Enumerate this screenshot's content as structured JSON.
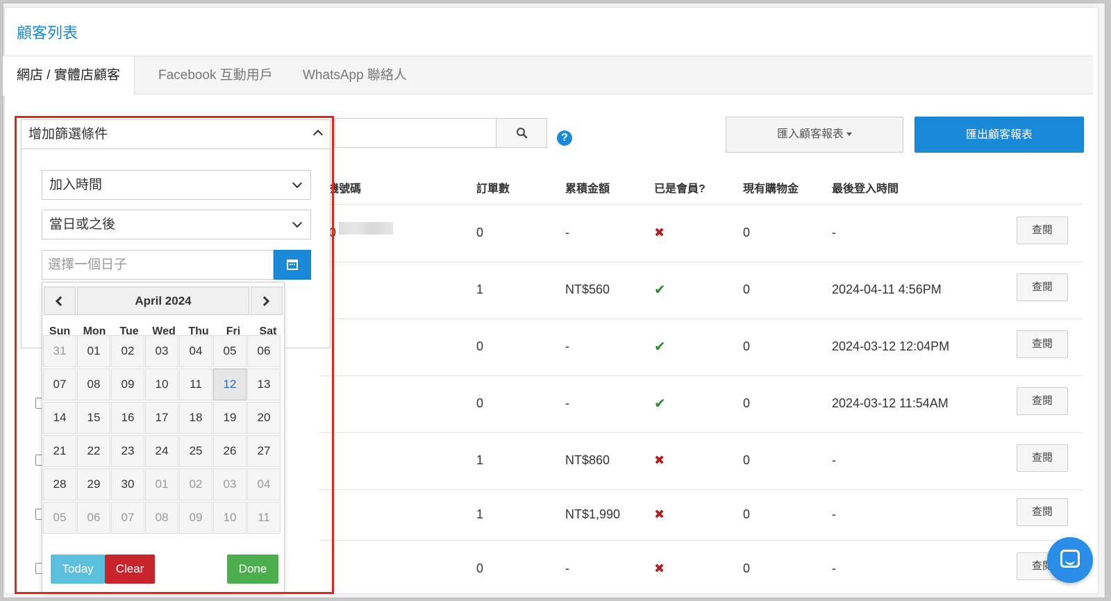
{
  "page_title": "顧客列表",
  "tabs": [
    {
      "label": "網店 / 實體店顧客"
    },
    {
      "label": "Facebook 互動用戶"
    },
    {
      "label": "WhatsApp 聯絡人"
    }
  ],
  "toolbar": {
    "import_label": "匯入顧客報表",
    "export_label": "匯出顧客報表",
    "help_label": "?"
  },
  "filter": {
    "header": "增加篩選條件",
    "field_select": "加入時間",
    "condition_select": "當日或之後",
    "date_placeholder": "選擇一個日子"
  },
  "datepicker": {
    "month_title": "April 2024",
    "weekdays": [
      "Sun",
      "Mon",
      "Tue",
      "Wed",
      "Thu",
      "Fri",
      "Sat"
    ],
    "weeks": [
      [
        "31",
        "01",
        "02",
        "03",
        "04",
        "05",
        "06"
      ],
      [
        "07",
        "08",
        "09",
        "10",
        "11",
        "12",
        "13"
      ],
      [
        "14",
        "15",
        "16",
        "17",
        "18",
        "19",
        "20"
      ],
      [
        "21",
        "22",
        "23",
        "24",
        "25",
        "26",
        "27"
      ],
      [
        "28",
        "29",
        "30",
        "01",
        "02",
        "03",
        "04"
      ],
      [
        "05",
        "06",
        "07",
        "08",
        "09",
        "10",
        "11"
      ]
    ],
    "today_label": "Today",
    "clear_label": "Clear",
    "done_label": "Done"
  },
  "table": {
    "headers": {
      "phone_partial": "機號碼",
      "orders": "訂單數",
      "total": "累積金額",
      "member": "已是會員?",
      "credit": "現有購物金",
      "last_login": "最後登入時間"
    },
    "first_row_phone_partial": "0",
    "rows": [
      {
        "orders": "0",
        "total": "-",
        "member": "x",
        "credit": "0",
        "last_login": "-",
        "view": "查閱"
      },
      {
        "orders": "1",
        "total": "NT$560",
        "member": "check",
        "credit": "0",
        "last_login": "2024-04-11 4:56PM",
        "view": "查閱"
      },
      {
        "orders": "0",
        "total": "-",
        "member": "check",
        "credit": "0",
        "last_login": "2024-03-12 12:04PM",
        "view": "查閱"
      },
      {
        "orders": "0",
        "total": "-",
        "member": "check",
        "credit": "0",
        "last_login": "2024-03-12 11:54AM",
        "view": "查閱"
      },
      {
        "orders": "1",
        "total": "NT$860",
        "member": "x",
        "credit": "0",
        "last_login": "-",
        "view": "查閱"
      },
      {
        "orders": "1",
        "total": "NT$1,990",
        "member": "x",
        "credit": "0",
        "last_login": "-",
        "view": "查閱"
      },
      {
        "orders": "0",
        "total": "-",
        "member": "x",
        "credit": "0",
        "last_login": "-",
        "view": "查閱"
      }
    ]
  },
  "colors": {
    "accent": "#1a8ad8",
    "highlight": "#e2261c",
    "check": "#2b8a2b",
    "cross": "#b11d1d"
  }
}
